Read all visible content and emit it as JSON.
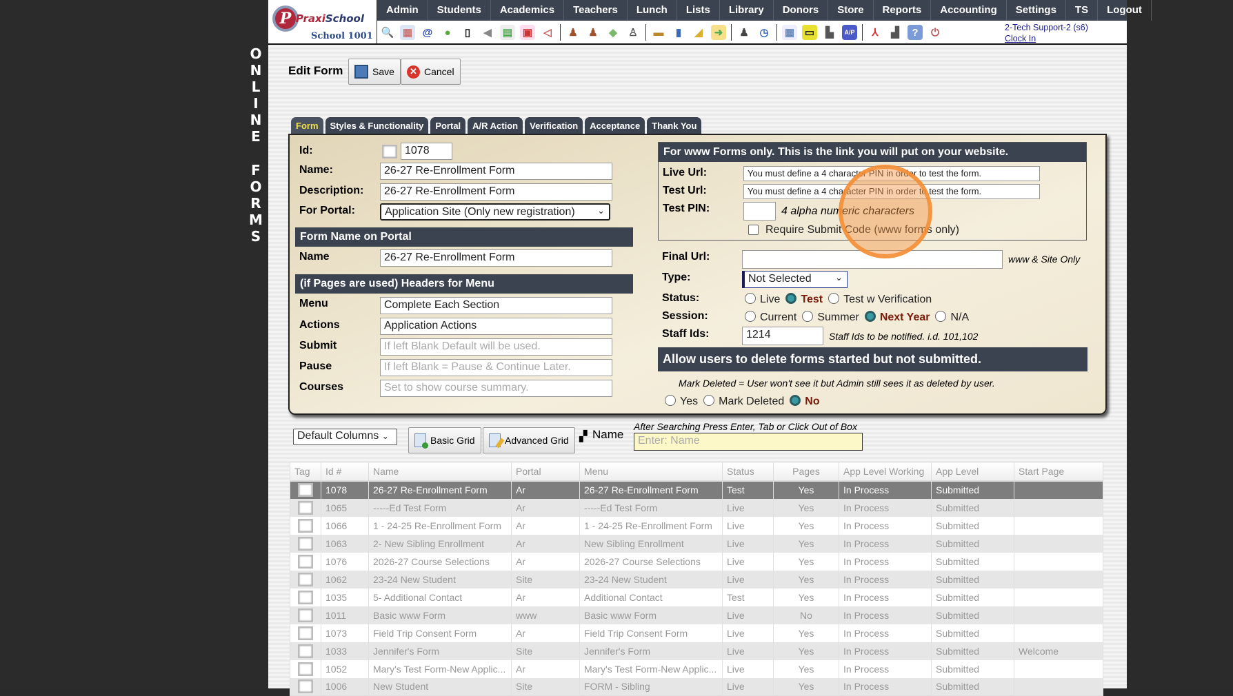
{
  "sidebar": {
    "vertical_letters": [
      "O",
      "N",
      "L",
      "I",
      "N",
      "E",
      "F",
      "O",
      "R",
      "M",
      "S"
    ]
  },
  "header": {
    "logo_initials": "P",
    "brand_a": "Praxi",
    "brand_b": "School",
    "school": "School 1001",
    "nav": [
      "Admin",
      "Students",
      "Academics",
      "Teachers",
      "Lunch",
      "Lists",
      "Library",
      "Donors",
      "Store",
      "Reports",
      "Accounting",
      "Settings",
      "TS",
      "Logout"
    ],
    "icons": [
      "search-icon",
      "calendar-grid-icon",
      "email-at-icon",
      "chat-icon",
      "mobile-phone-icon",
      "speaker-icon",
      "schedule-icon",
      "calendar-icon",
      "megaphone-icon",
      "|",
      "add-student-icon",
      "student-icon",
      "money-icon",
      "parents-icon",
      "|",
      "lunch-icon",
      "book-icon",
      "bell-icon",
      "export-icon",
      "|",
      "staff-icon",
      "clock-icon",
      "|",
      "spreadsheet-icon",
      "card-icon",
      "printer-icon",
      "ap-icon",
      "|",
      "pdf-icon",
      "cash-register-icon",
      "help-icon",
      "power-icon"
    ],
    "user": "2-Tech Support-2 (s6)",
    "clock_in": "Clock In"
  },
  "toolbar": {
    "title": "Edit Form",
    "save": "Save",
    "cancel": "Cancel"
  },
  "tabs": [
    "Form",
    "Styles & Functionality",
    "Portal",
    "A/R Action",
    "Verification",
    "Acceptance",
    "Thank You"
  ],
  "form": {
    "id_label": "Id:",
    "id_value": "1078",
    "name_label": "Name:",
    "name_value": "26-27 Re-Enrollment Form",
    "desc_label": "Description:",
    "desc_value": "26-27 Re-Enrollment Form",
    "portal_label": "For Portal:",
    "portal_value": "Application Site (Only new registration)",
    "portal_header": "Form Name on Portal",
    "portal_name_label": "Name",
    "portal_name_value": "26-27 Re-Enrollment Form",
    "menu_header": "(if Pages are used) Headers for Menu",
    "menu_label": "Menu",
    "menu_value": "Complete Each Section",
    "actions_label": "Actions",
    "actions_value": "Application Actions",
    "submit_label": "Submit",
    "submit_placeholder": "If left Blank Default will be used.",
    "pause_label": "Pause",
    "pause_placeholder": "If left Blank = Pause & Continue Later.",
    "courses_label": "Courses",
    "courses_placeholder": "Set to show course summary."
  },
  "www": {
    "header": "For www Forms only. This is the link you will put on your website.",
    "live_label": "Live Url:",
    "live_value": "You must define a 4 character PIN in order to test the form.",
    "test_label": "Test Url:",
    "test_value": "You must define a 4 character PIN in order to test the form.",
    "pin_label": "Test PIN:",
    "pin_hint": "4 alpha numeric characters",
    "submit_code": "Require Submit Code (www forms only)",
    "final_label": "Final Url:",
    "final_hint": "www & Site Only",
    "type_label": "Type:",
    "type_value": "Not Selected",
    "status_label": "Status:",
    "status_options": [
      "Live",
      "Test",
      "Test w Verification"
    ],
    "status_selected": "Test",
    "session_label": "Session:",
    "session_options": [
      "Current",
      "Summer",
      "Next Year",
      "N/A"
    ],
    "session_selected": "Next Year",
    "staff_label": "Staff Ids:",
    "staff_value": "1214",
    "staff_hint": "Staff Ids to be notified. i.d. 101,102",
    "delete_header": "Allow users to delete forms started but not submitted.",
    "delete_note": "Mark Deleted = User won't see it but Admin still sees it as deleted by user.",
    "delete_options": [
      "Yes",
      "Mark Deleted",
      "No"
    ],
    "delete_selected": "No"
  },
  "grid_controls": {
    "columns_select": "Default Columns",
    "basic_grid": "Basic Grid",
    "advanced_grid": "Advanced Grid",
    "search_label": "Name",
    "search_hint": "After Searching Press Enter, Tab or Click Out of Box",
    "search_placeholder": "Enter: Name"
  },
  "grid": {
    "columns": [
      "Tag",
      "Id #",
      "Name",
      "Portal",
      "Menu",
      "Status",
      "Pages",
      "App Level Working",
      "App Level",
      "Start Page"
    ],
    "rows": [
      [
        "1078",
        "26-27 Re-Enrollment Form",
        "Ar",
        "26-27 Re-Enrollment Form",
        "Test",
        "Yes",
        "In Process",
        "Submitted",
        ""
      ],
      [
        "1065",
        "-----Ed Test Form",
        "Ar",
        "-----Ed Test Form",
        "Live",
        "Yes",
        "In Process",
        "Submitted",
        ""
      ],
      [
        "1066",
        "1 - 24-25 Re-Enrollment Form",
        "Ar",
        "1 - 24-25 Re-Enrollment Form",
        "Live",
        "Yes",
        "In Process",
        "Submitted",
        ""
      ],
      [
        "1063",
        "2- New Sibling Enrollment",
        "Ar",
        "New Sibling Enrollment",
        "Live",
        "Yes",
        "In Process",
        "Submitted",
        ""
      ],
      [
        "1076",
        "2026-27 Course Selections",
        "Ar",
        "2026-27 Course Selections",
        "Live",
        "Yes",
        "In Process",
        "Submitted",
        ""
      ],
      [
        "1062",
        "23-24 New Student",
        "Site",
        "23-24 New Student",
        "Live",
        "Yes",
        "In Process",
        "Submitted",
        ""
      ],
      [
        "1035",
        "5- Additional Contact",
        "Ar",
        "Additional Contact",
        "Test",
        "Yes",
        "In Process",
        "Submitted",
        ""
      ],
      [
        "1011",
        "Basic www Form",
        "www",
        "Basic www Form",
        "Live",
        "No",
        "In Process",
        "Submitted",
        ""
      ],
      [
        "1073",
        "Field Trip Consent Form",
        "Ar",
        "Field Trip Consent Form",
        "Live",
        "Yes",
        "In Process",
        "Submitted",
        ""
      ],
      [
        "1033",
        "Jennifer's Form",
        "Site",
        "Jennifer's Form",
        "Live",
        "Yes",
        "In Process",
        "Submitted",
        "Welcome"
      ],
      [
        "1052",
        "Mary's Test Form-New Applic...",
        "Ar",
        "Mary's Test Form-New Applic...",
        "Live",
        "Yes",
        "In Process",
        "Submitted",
        ""
      ],
      [
        "1006",
        "New Student",
        "Site",
        "FORM - Sibling",
        "Live",
        "Yes",
        "In Process",
        "Submitted",
        ""
      ]
    ]
  },
  "colors": {
    "nav_bg": "#3b4350",
    "active_tab": "#f2e04a",
    "radio_on": "#3a9aa3",
    "selected_row": "#7d7d7d",
    "highlight_ring": "#f58c32"
  }
}
